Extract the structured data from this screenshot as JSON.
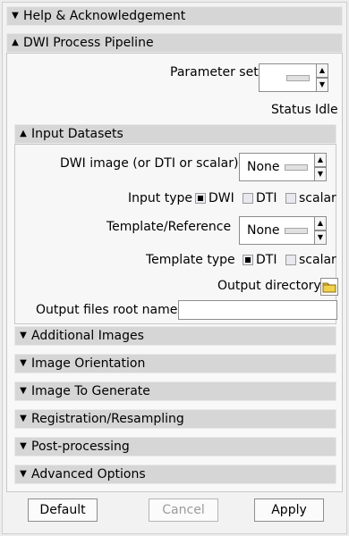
{
  "sections": {
    "help": "Help & Acknowledgement",
    "dwi_pipeline": "DWI Process Pipeline",
    "input_datasets": "Input Datasets",
    "additional_images": "Additional Images",
    "image_orientation": "Image Orientation",
    "image_to_generate": "Image To Generate",
    "registration": "Registration/Resampling",
    "post_processing": "Post-processing",
    "advanced_options": "Advanced Options"
  },
  "pipeline": {
    "parameter_set_label": "Parameter set",
    "parameter_set_value": "",
    "status_text": "Status Idle"
  },
  "input": {
    "dwi_label": "DWI image (or DTI or scalar)",
    "dwi_value": "None",
    "input_type_label": "Input type",
    "input_type_options": [
      "DWI",
      "DTI",
      "scalar"
    ],
    "input_type_selected": "DWI",
    "template_label": "Template/Reference",
    "template_value": "None",
    "template_type_label": "Template type",
    "template_type_options": [
      "DTI",
      "scalar"
    ],
    "template_type_selected": "DTI",
    "output_dir_label": "Output directory",
    "output_root_label": "Output files root name",
    "output_root_value": ""
  },
  "buttons": {
    "default": "Default",
    "cancel": "Cancel",
    "apply": "Apply"
  },
  "colors": {
    "header_bg": "#d6d6d6",
    "panel_bg": "#f8f8f8",
    "disabled_text": "#9b9b9b",
    "folder_yellow": "#f0d14b"
  }
}
